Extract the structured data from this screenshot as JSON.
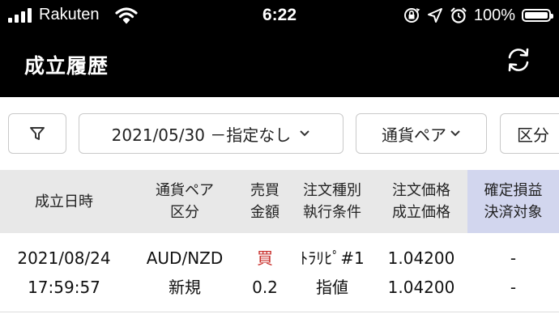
{
  "status_bar": {
    "carrier": "Rakuten",
    "time": "6:22",
    "battery": "100%",
    "icons": [
      "signal-icon",
      "wifi-icon",
      "orientation-lock-icon",
      "location-arrow-icon",
      "alarm-icon",
      "battery-icon"
    ]
  },
  "header": {
    "title": "成立履歴",
    "refresh_icon": "refresh-icon"
  },
  "filters": {
    "filter_icon": "filter-icon",
    "date_range": "2021/05/30 －指定なし",
    "currency_pair": "通貨ペア",
    "kubun": "区分"
  },
  "table": {
    "columns": [
      {
        "line1": "成立日時",
        "line2": ""
      },
      {
        "line1": "通貨ペア",
        "line2": "区分"
      },
      {
        "line1": "売買",
        "line2": "金額"
      },
      {
        "line1": "注文種別",
        "line2": "執行条件"
      },
      {
        "line1": "注文価格",
        "line2": "成立価格"
      },
      {
        "line1": "確定損益",
        "line2": "決済対象"
      }
    ],
    "rows": [
      {
        "date": "2021/08/24",
        "time": "17:59:57",
        "pair": "AUD/NZD",
        "kubun": "新規",
        "side": "買",
        "amount": "0.2",
        "order_type": "ﾄﾗﾘﾋﾟ#1",
        "condition": "指値",
        "order_price": "1.04200",
        "exec_price": "1.04200",
        "pnl": "-",
        "settle_target": "-"
      }
    ]
  },
  "colors": {
    "header_bg": "#000000",
    "table_header_bg": "#e8e8e8",
    "highlight_header_bg": "#d2d6ee",
    "buy": "#c9302c"
  }
}
